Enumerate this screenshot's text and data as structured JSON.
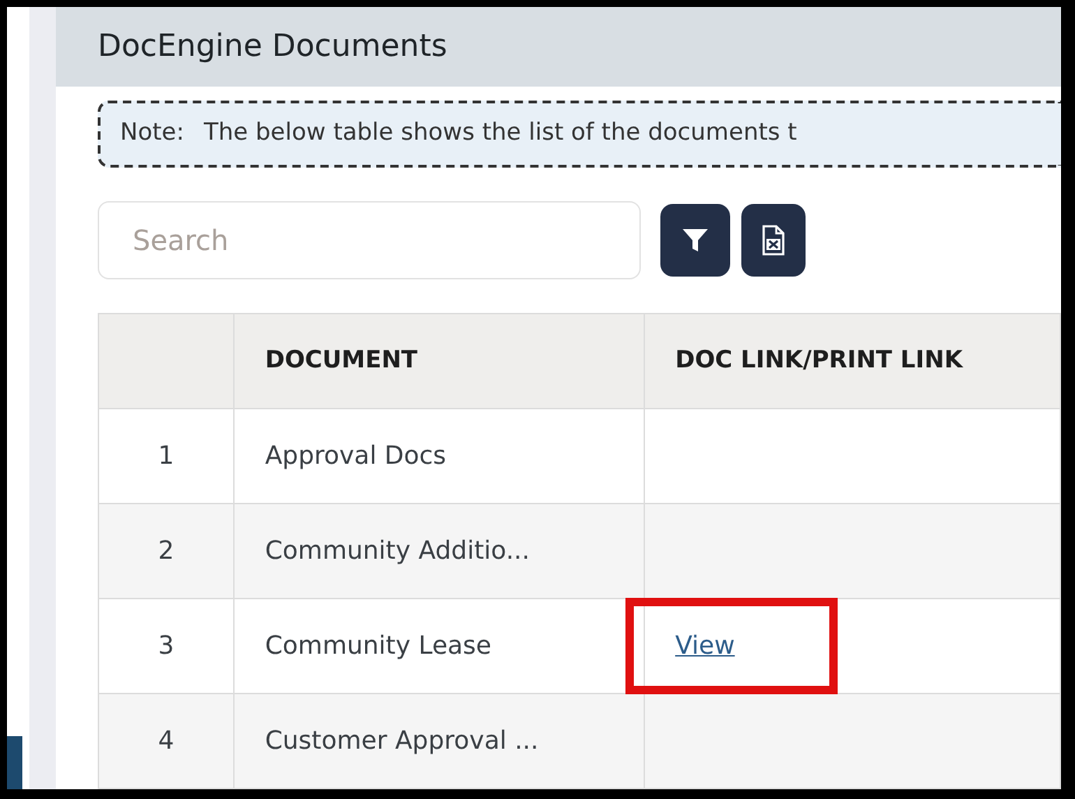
{
  "panel": {
    "title": "DocEngine Documents"
  },
  "note": {
    "label": "Note:",
    "text": "The below table shows the list of the documents t"
  },
  "search": {
    "placeholder": "Search"
  },
  "table": {
    "columns": [
      "",
      "DOCUMENT",
      "DOC LINK/PRINT LINK"
    ],
    "rows": [
      {
        "number": "1",
        "document": "Approval Docs"
      },
      {
        "number": "2",
        "document": "Community Additio..."
      },
      {
        "number": "3",
        "document": "Community Lease",
        "link": "View",
        "highlighted": true
      },
      {
        "number": "4",
        "document": "Customer Approval ..."
      }
    ]
  }
}
